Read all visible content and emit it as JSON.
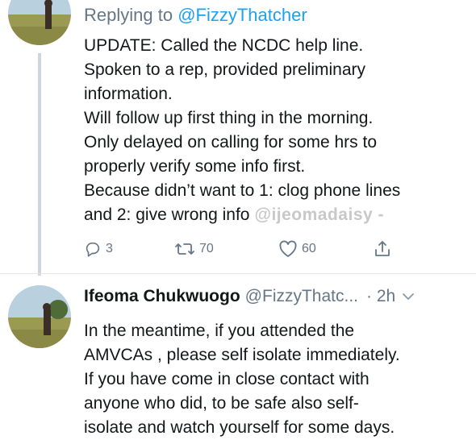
{
  "tweet_1": {
    "reply_prefix": "Replying to",
    "reply_handle": "@FizzyThatcher",
    "lines": [
      "UPDATE: Called the NCDC help line.",
      "Spoken to a rep, provided preliminary",
      "information.",
      "Will follow up first thing in the morning.",
      "Only delayed on calling for some hrs to",
      "properly verify some info first.",
      "Because didn’t want to 1: clog phone lines",
      "and 2: give wrong info"
    ],
    "watermark": "@ijeomadaisy -",
    "actions": {
      "reply_count": "3",
      "retweet_count": "70",
      "like_count": "60"
    }
  },
  "tweet_2": {
    "display_name": "Ifeoma Chukwuogo",
    "username": "@FizzyThatc...",
    "timestamp": "· 2h",
    "lines": [
      "In the meantime, if you attended the",
      "AMVCAs , please self isolate immediately.",
      "If you have come in close contact with",
      "anyone who did, to be safe also self-",
      "isolate and watch yourself for some days."
    ]
  },
  "colors": {
    "text": "#14171a",
    "secondary": "#657786",
    "link": "#1da1f2",
    "thread_line": "#cdd6dd",
    "divider": "#e1e8ed"
  },
  "icons": {
    "reply": "reply-icon",
    "retweet": "retweet-icon",
    "like": "heart-icon",
    "share": "share-icon",
    "caret": "chevron-down-icon"
  }
}
